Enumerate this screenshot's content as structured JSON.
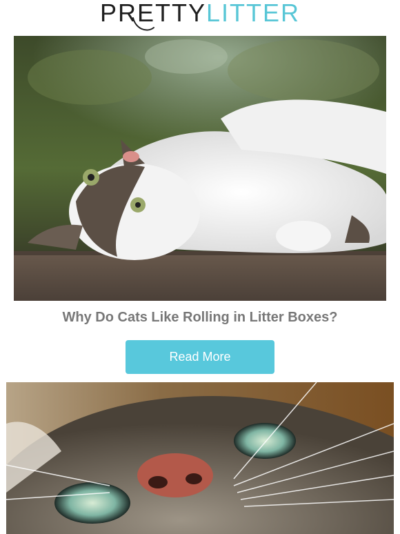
{
  "brand": {
    "part1": "PRETTY",
    "part2": "LITTER",
    "accent_color": "#58c6d6",
    "dark_color": "#1f1f1f"
  },
  "articles": [
    {
      "title": "Why Do Cats Like Rolling in Litter Boxes?",
      "button_label": "Read More",
      "button_color": "#58c8dc"
    }
  ]
}
